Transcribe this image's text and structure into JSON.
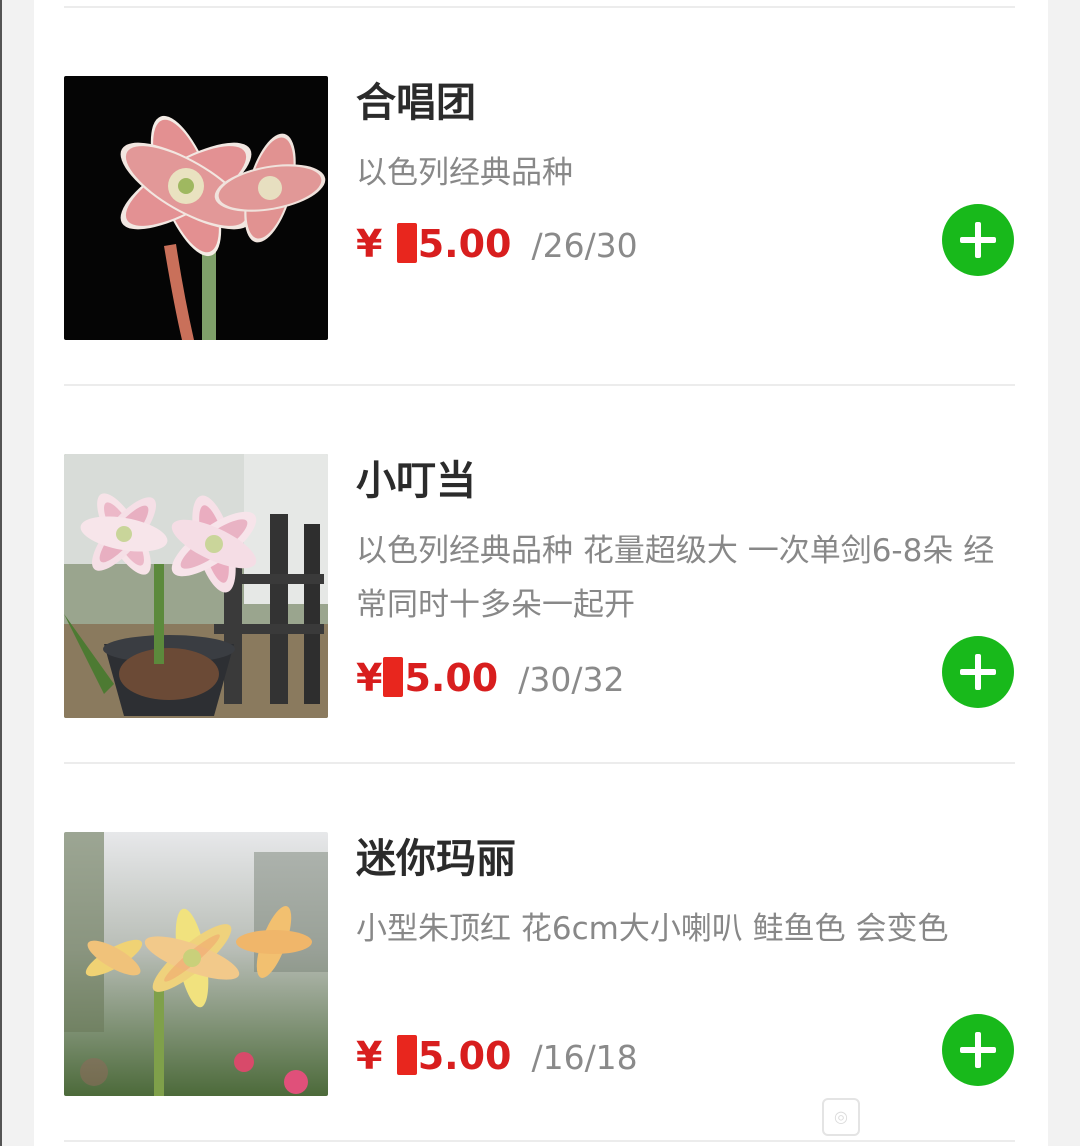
{
  "products": [
    {
      "name": "合唱团",
      "description": "以色列经典品种",
      "price_prefix": "¥",
      "price_suffix": "5.00",
      "stock": "/26/30",
      "add_icon": "plus-icon"
    },
    {
      "name": "小叮当",
      "description": "以色列经典品种 花量超级大 一次单剑6-8朵 经常同时十多朵一起开",
      "price_prefix": "¥",
      "price_suffix": "5.00",
      "stock": "/30/32",
      "add_icon": "plus-icon"
    },
    {
      "name": "迷你玛丽",
      "description": "小型朱顶红 花6cm大小喇叭 鲑鱼色 会变色",
      "price_prefix": "¥",
      "price_suffix": "5.00",
      "stock": "/16/18",
      "add_icon": "plus-icon"
    }
  ],
  "colors": {
    "price": "#d81e1e",
    "add_button": "#18b91b",
    "title": "#2b2b2b",
    "description": "#888888"
  }
}
